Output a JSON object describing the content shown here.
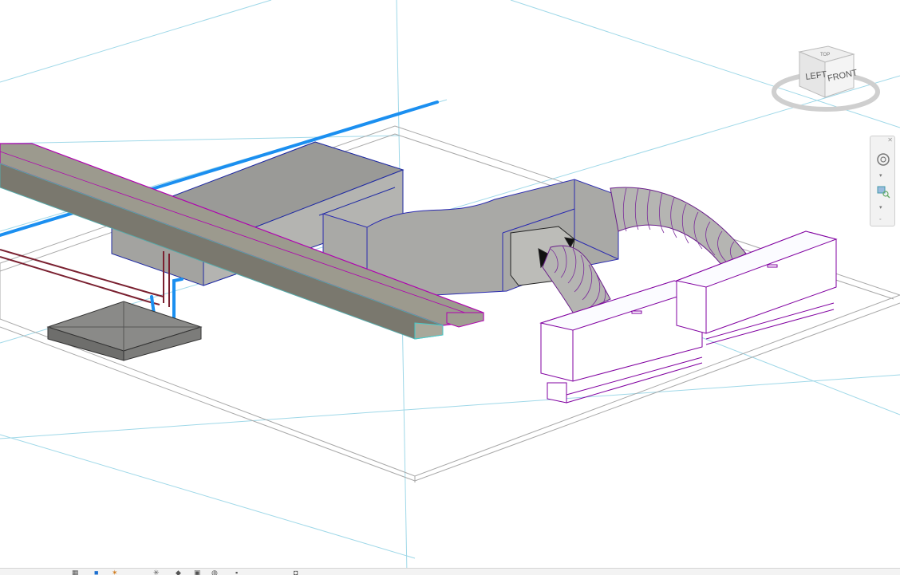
{
  "viewcube": {
    "left_label": "LEFT",
    "front_label": "FRONT",
    "top_label": "TOP"
  },
  "navigation_bar": {
    "icons": [
      "steering-wheel-icon",
      "zoom-region-icon"
    ]
  },
  "view_control_bar": {
    "icons": [
      "scale-icon",
      "detail-level-icon",
      "visual-style-icon",
      "sun-path-icon",
      "shadows-icon",
      "crop-icon",
      "show-crop-icon",
      "lock-3d-icon",
      "temporary-hide-icon"
    ]
  },
  "colors": {
    "duct_fill": "#a8a8a4",
    "duct_edge": "#1f2aa3",
    "pipe_blue": "#1e90ff",
    "beam_edge": "#b000b0",
    "fixture_edge": "#8000a0",
    "grid_line": "#8fd3e6",
    "pipe_maroon": "#7a2030"
  }
}
